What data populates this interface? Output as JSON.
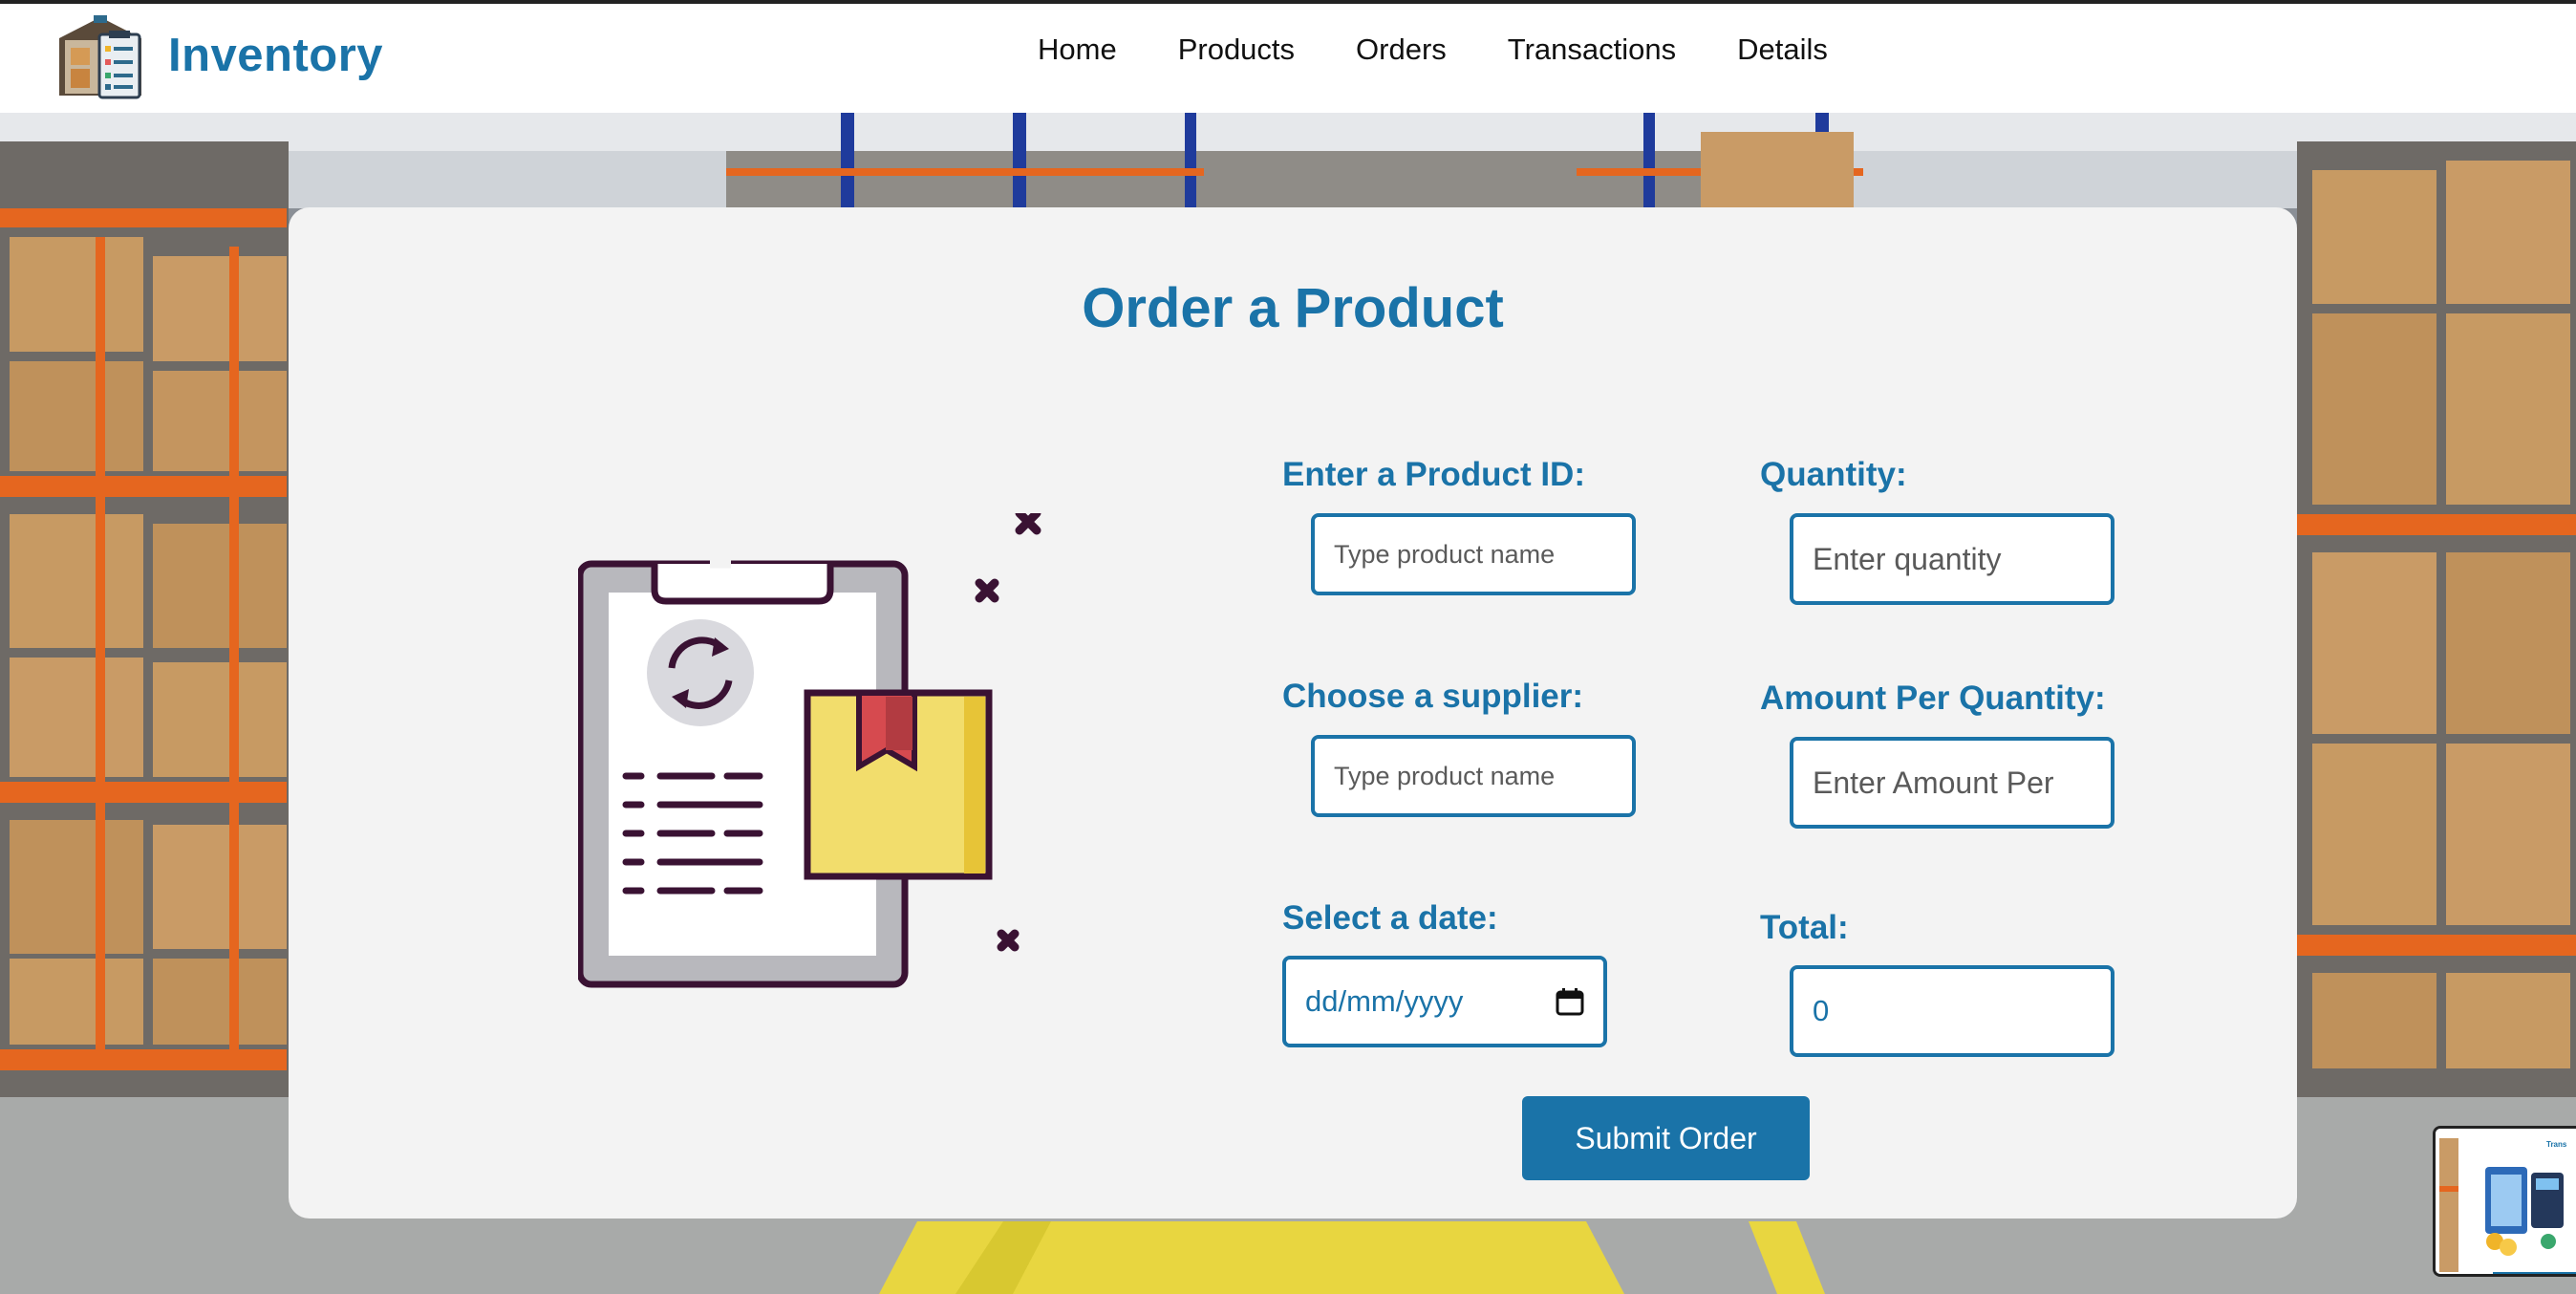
{
  "app": {
    "brand_name": "Inventory",
    "brand_color": "#1a73a8"
  },
  "nav": {
    "items": [
      {
        "label": "Home"
      },
      {
        "label": "Products"
      },
      {
        "label": "Orders"
      },
      {
        "label": "Transactions"
      },
      {
        "label": "Details"
      }
    ]
  },
  "form": {
    "title": "Order a Product",
    "product_id": {
      "label": "Enter a Product ID:",
      "placeholder": "Type product name",
      "value": ""
    },
    "quantity": {
      "label": "Quantity:",
      "placeholder": "Enter quantity",
      "value": ""
    },
    "supplier": {
      "label": "Choose a supplier:",
      "placeholder": "Type product name",
      "value": ""
    },
    "amount_per_quantity": {
      "label": "Amount Per Quantity:",
      "placeholder": "Enter Amount Per",
      "value": ""
    },
    "date": {
      "label": "Select a date:",
      "placeholder": "dd/mm/yyyy"
    },
    "total": {
      "label": "Total:",
      "value": "0"
    },
    "submit_label": "Submit Order"
  },
  "thumbnail": {
    "caption": "Trans"
  },
  "icons": {
    "brand": "warehouse-clipboard-icon",
    "illustration": "clipboard-package-illustration",
    "date": "calendar-icon"
  },
  "colors": {
    "accent": "#1a73a8",
    "card_bg": "#f3f3f3",
    "header_bg": "#ffffff"
  }
}
